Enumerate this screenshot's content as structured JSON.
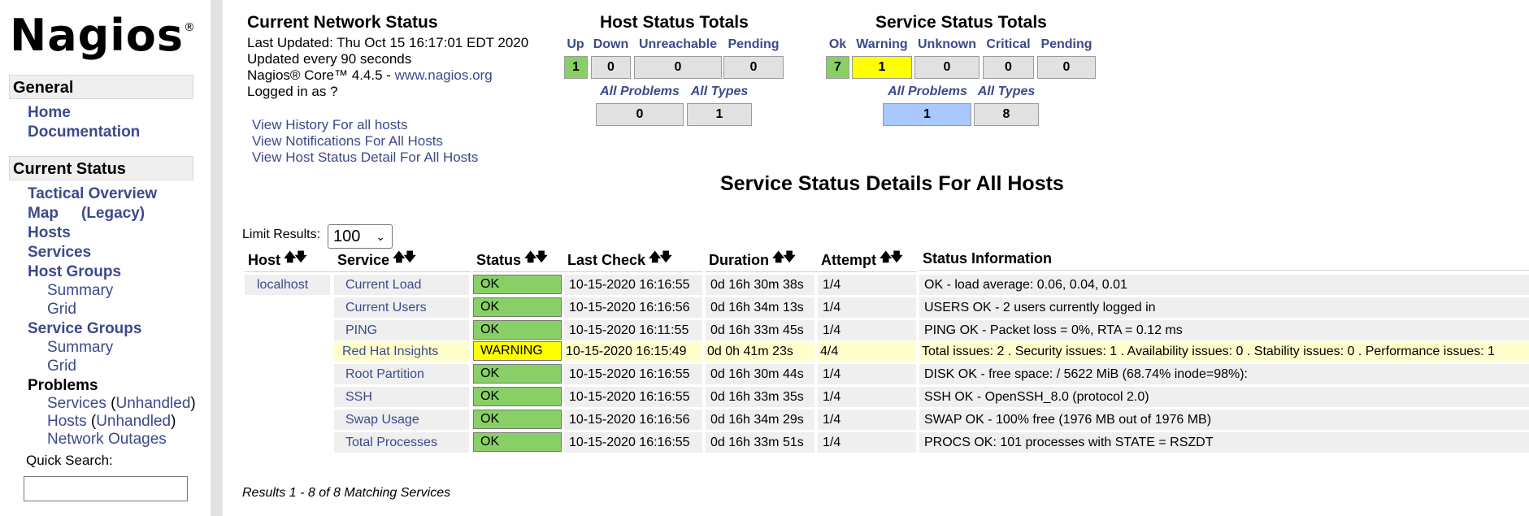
{
  "nav": {
    "logo": "Nagios",
    "logo_mark": "®",
    "general_header": "General",
    "home": "Home",
    "documentation": "Documentation",
    "current_status_header": "Current Status",
    "tactical_overview": "Tactical Overview",
    "map": "Map",
    "map_legacy": "(Legacy)",
    "hosts": "Hosts",
    "services": "Services",
    "host_groups": "Host Groups",
    "host_groups_summary": "Summary",
    "host_groups_grid": "Grid",
    "service_groups": "Service Groups",
    "service_groups_summary": "Summary",
    "service_groups_grid": "Grid",
    "problems": "Problems",
    "problems_services": "Services",
    "problems_services_unhandled": "Unhandled",
    "problems_hosts": "Hosts",
    "problems_hosts_unhandled": "Unhandled",
    "network_outages": "Network Outages",
    "quick_search_label": "Quick Search:",
    "quick_search_value": ""
  },
  "network_status": {
    "title": "Current Network Status",
    "last_updated": "Last Updated: Thu Oct 15 16:17:01 EDT 2020",
    "update_interval": "Updated every 90 seconds",
    "version_prefix": "Nagios® Core™ 4.4.5 - ",
    "version_link": "www.nagios.org",
    "logged_in": "Logged in as ?",
    "links": [
      "View History For all hosts",
      "View Notifications For All Hosts",
      "View Host Status Detail For All Hosts"
    ]
  },
  "host_totals": {
    "title": "Host Status Totals",
    "headers": [
      "Up",
      "Down",
      "Unreachable",
      "Pending"
    ],
    "values": [
      "1",
      "0",
      "0",
      "0"
    ],
    "sub_headers": [
      "All Problems",
      "All Types"
    ],
    "sub_values": [
      "0",
      "1"
    ]
  },
  "service_totals": {
    "title": "Service Status Totals",
    "headers": [
      "Ok",
      "Warning",
      "Unknown",
      "Critical",
      "Pending"
    ],
    "values": [
      "7",
      "1",
      "0",
      "0",
      "0"
    ],
    "sub_headers": [
      "All Problems",
      "All Types"
    ],
    "sub_values": [
      "1",
      "8"
    ]
  },
  "details": {
    "title": "Service Status Details For All Hosts",
    "limit_label": "Limit Results:",
    "limit_value": "100",
    "columns": [
      "Host",
      "Service",
      "Status",
      "Last Check",
      "Duration",
      "Attempt",
      "Status Information"
    ],
    "host": "localhost",
    "rows": [
      {
        "service": "Current Load",
        "status": "OK",
        "last_check": "10-15-2020 16:16:55",
        "duration": "0d 16h 30m 38s",
        "attempt": "1/4",
        "info": "OK - load average: 0.06, 0.04, 0.01"
      },
      {
        "service": "Current Users",
        "status": "OK",
        "last_check": "10-15-2020 16:16:56",
        "duration": "0d 16h 34m 13s",
        "attempt": "1/4",
        "info": "USERS OK - 2 users currently logged in"
      },
      {
        "service": "PING",
        "status": "OK",
        "last_check": "10-15-2020 16:11:55",
        "duration": "0d 16h 33m 45s",
        "attempt": "1/4",
        "info": "PING OK - Packet loss = 0%, RTA = 0.12 ms"
      },
      {
        "service": "Red Hat Insights",
        "status": "WARNING",
        "last_check": "10-15-2020 16:15:49",
        "duration": "0d 0h 41m 23s",
        "attempt": "4/4",
        "info": "Total issues: 2 . Security issues: 1 . Availability issues: 0 . Stability issues: 0 . Performance issues: 1"
      },
      {
        "service": "Root Partition",
        "status": "OK",
        "last_check": "10-15-2020 16:16:55",
        "duration": "0d 16h 30m 44s",
        "attempt": "1/4",
        "info": "DISK OK - free space: / 5622 MiB (68.74% inode=98%):"
      },
      {
        "service": "SSH",
        "status": "OK",
        "last_check": "10-15-2020 16:16:55",
        "duration": "0d 16h 33m 35s",
        "attempt": "1/4",
        "info": "SSH OK - OpenSSH_8.0 (protocol 2.0)"
      },
      {
        "service": "Swap Usage",
        "status": "OK",
        "last_check": "10-15-2020 16:16:56",
        "duration": "0d 16h 34m 29s",
        "attempt": "1/4",
        "info": "SWAP OK - 100% free (1976 MB out of 1976 MB)"
      },
      {
        "service": "Total Processes",
        "status": "OK",
        "last_check": "10-15-2020 16:16:55",
        "duration": "0d 16h 33m 51s",
        "attempt": "1/4",
        "info": "PROCS OK: 101 processes with STATE = RSZDT"
      }
    ],
    "footer": "Results 1 - 8 of 8 Matching Services"
  },
  "colors": {
    "ok": "#88d066",
    "warning": "#ffff00",
    "link": "#3b4a8c",
    "highlight": "#a8c8ff"
  }
}
